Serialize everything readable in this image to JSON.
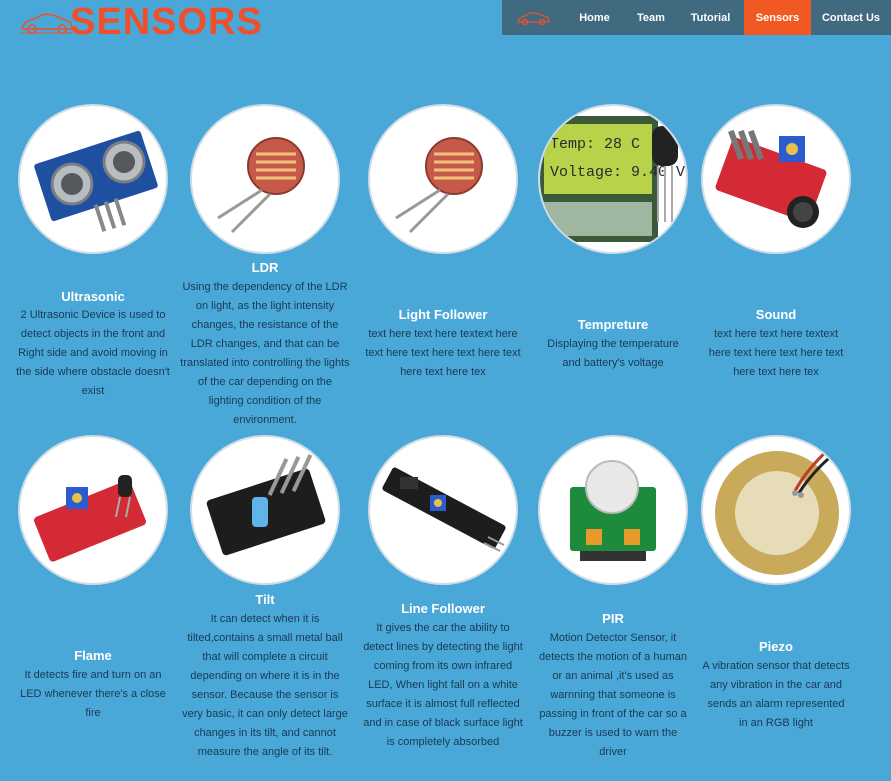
{
  "header": {
    "logo_text": "SENSORS",
    "nav": [
      {
        "label": "Home"
      },
      {
        "label": "Team"
      },
      {
        "label": "Tutorial"
      },
      {
        "label": "Sensors",
        "active": true
      },
      {
        "label": "Contact Us"
      }
    ]
  },
  "colors": {
    "background": "#4aa8d8",
    "accent": "#f05a22",
    "nav_bg": "#3f6a80"
  },
  "sensors": [
    {
      "title": "Ultrasonic",
      "icon": "ultrasonic-sensor-image",
      "desc": "2 Ultrasonic Device is used to detect objects in the front and Right side and avoid moving in the side where obstacle doesn't exist"
    },
    {
      "title": "LDR",
      "icon": "ldr-image",
      "desc": "Using the dependency of the LDR on light, as the light intensity changes, the resistance of the LDR changes, and that can be translated into controlling the lights of the car depending on the lighting condition of the environment."
    },
    {
      "title": "Light Follower",
      "icon": "light-follower-image",
      "desc": "text here text here textext here text here text here text here text here text here tex"
    },
    {
      "title": "Tempreture",
      "icon": "temperature-lcd-image",
      "desc": "Displaying the temperature and battery's voltage",
      "lcd_line1": "Temp:  28  C",
      "lcd_line2": "Voltage: 9.40 V"
    },
    {
      "title": "Sound",
      "icon": "sound-sensor-image",
      "desc": "text here text here textext here text here text here text here text here tex"
    },
    {
      "title": "Flame",
      "icon": "flame-sensor-image",
      "desc": "It detects fire and turn on an LED whenever there's a close fire"
    },
    {
      "title": "Tilt",
      "icon": "tilt-sensor-image",
      "desc": "It can detect when it is tilted,contains a small metal ball that will complete a circuit depending on where it is in the sensor. Because the sensor is very basic, it can only detect large changes in its tilt, and cannot measure the angle of its tilt."
    },
    {
      "title": "Line Follower",
      "icon": "line-follower-image",
      "desc": "It gives the car the ability to detect lines by detecting the light coming from its own infrared LED, When light fall on a white surface it is almost full reflected and in case of black surface light is completely absorbed"
    },
    {
      "title": "PIR",
      "icon": "pir-sensor-image",
      "desc": "Motion Detector Sensor, it detects the motion of a human or an animal ,it's used as warnning that someone is passing in front of the car so a buzzer is used to warn the driver"
    },
    {
      "title": "Piezo",
      "icon": "piezo-sensor-image",
      "desc": "A vibration sensor that detects any vibration in the car and sends an alarm represented in an RGB light"
    }
  ]
}
